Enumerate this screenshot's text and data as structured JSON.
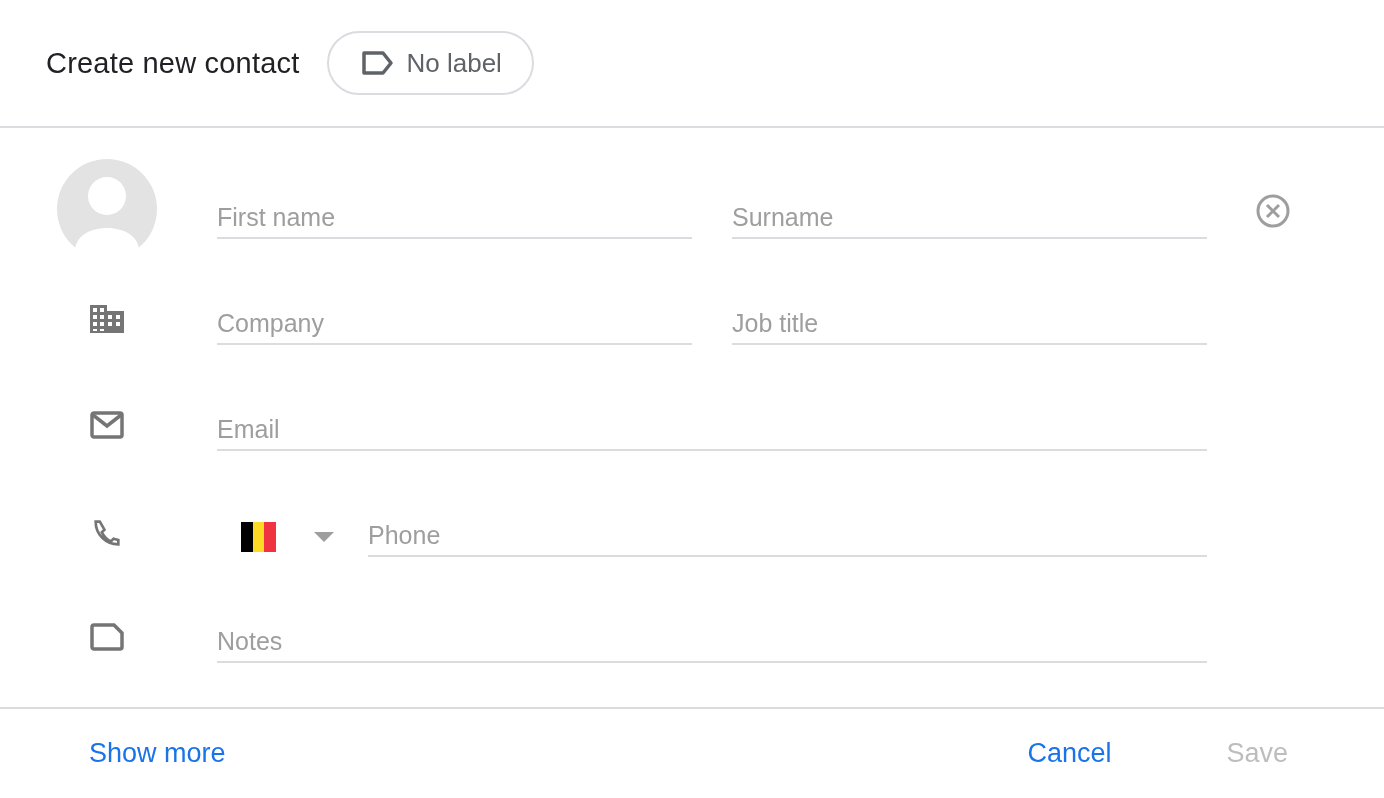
{
  "dialog": {
    "title": "Create new contact",
    "label_chip": "No label"
  },
  "rows": [
    {
      "kind": "name",
      "fields": [
        {
          "placeholder": "First name"
        },
        {
          "placeholder": "Surname"
        }
      ]
    },
    {
      "kind": "company",
      "fields": [
        {
          "placeholder": "Company"
        },
        {
          "placeholder": "Job title"
        }
      ]
    },
    {
      "kind": "email",
      "fields": [
        {
          "placeholder": "Email"
        }
      ]
    },
    {
      "kind": "phone",
      "fields": [
        {
          "placeholder": "Phone"
        }
      ]
    },
    {
      "kind": "notes",
      "fields": [
        {
          "placeholder": "Notes"
        }
      ]
    }
  ],
  "footer": {
    "show_more": "Show more",
    "buttons": [
      {
        "label": "Cancel",
        "disabled": false
      },
      {
        "label": "Save",
        "disabled": true
      }
    ]
  }
}
